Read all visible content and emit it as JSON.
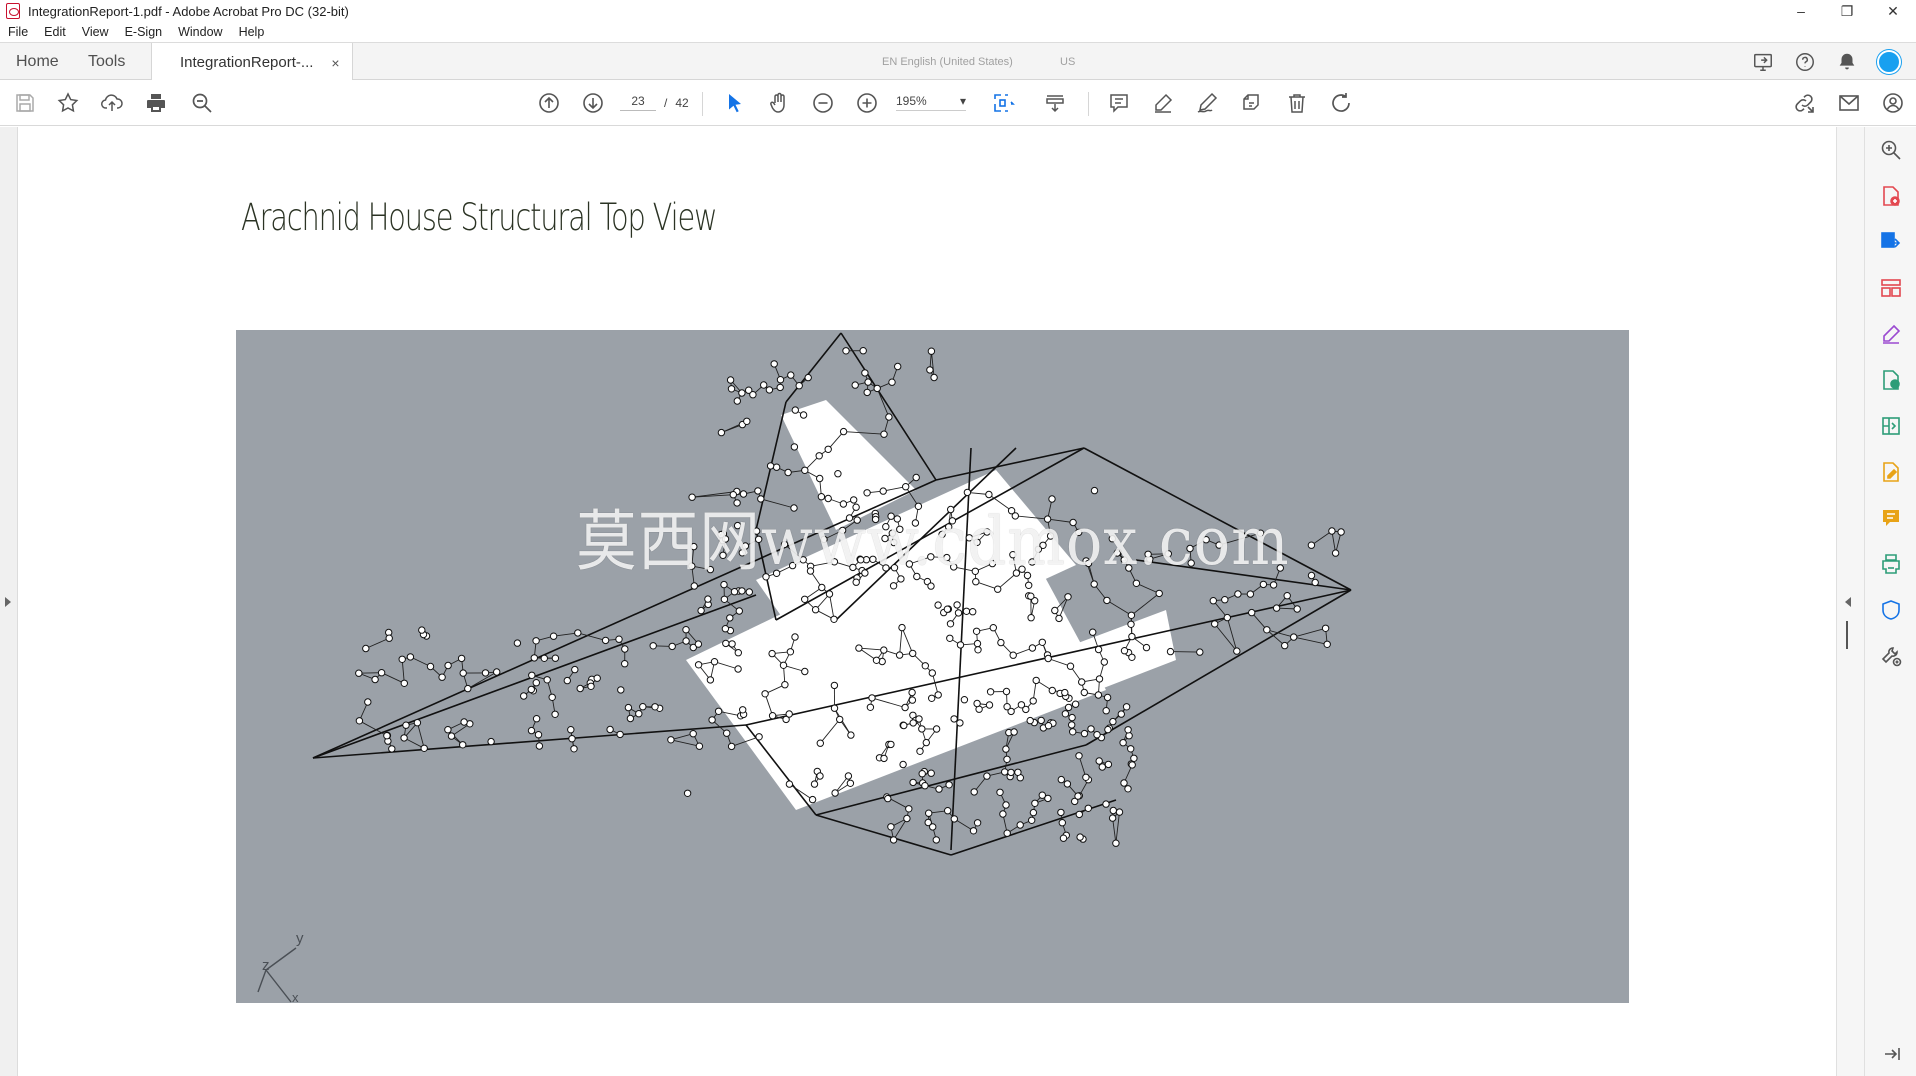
{
  "window": {
    "title": "IntegrationReport-1.pdf - Adobe Acrobat Pro DC (32-bit)",
    "controls": {
      "minimize": "–",
      "restore": "❐",
      "close": "✕"
    }
  },
  "menu": [
    "File",
    "Edit",
    "View",
    "E-Sign",
    "Window",
    "Help"
  ],
  "tabs": {
    "home": "Home",
    "tools": "Tools",
    "document": "IntegrationReport-...",
    "close": "×"
  },
  "language_bar": {
    "language": "EN English (United States)",
    "layout": "US"
  },
  "toolbar": {
    "current_page": "23",
    "page_separator": "/",
    "total_pages": "42",
    "zoom": "195%",
    "zoom_arrow": "▾"
  },
  "document": {
    "title": "Arachnid House Structural Top View",
    "axis_labels": {
      "y": "y",
      "z": "z",
      "x": "x"
    },
    "watermark": "莫西网www.cdmox.com"
  },
  "right_pane_icons": [
    "zoom-icon",
    "create-pdf-icon",
    "export-pdf-icon",
    "organize-pages-icon",
    "fill-sign-icon",
    "combine-files-icon",
    "compress-pdf-icon",
    "edit-pdf-icon",
    "comment-icon",
    "print-production-icon",
    "protect-icon",
    "more-tools-icon"
  ],
  "colors": {
    "figure_background": "#9ba1a8",
    "accent_blue": "#1473e6",
    "profile_blue": "#18a0f0",
    "title_text": "#2b3324"
  }
}
